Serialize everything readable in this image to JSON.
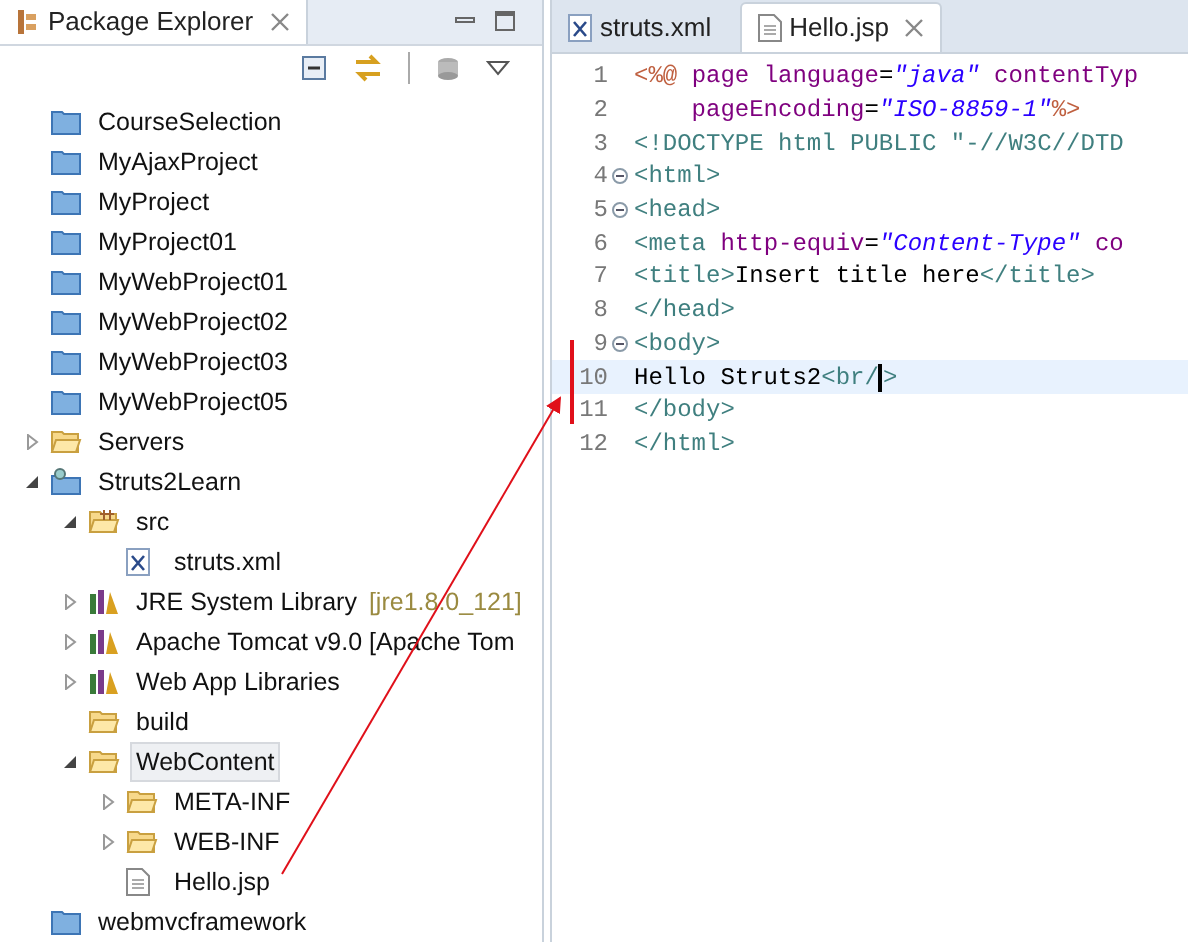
{
  "explorer": {
    "title": "Package Explorer",
    "tree": [
      {
        "label": "CourseSelection",
        "kind": "project"
      },
      {
        "label": "MyAjaxProject",
        "kind": "project"
      },
      {
        "label": "MyProject",
        "kind": "project"
      },
      {
        "label": "MyProject01",
        "kind": "project"
      },
      {
        "label": "MyWebProject01",
        "kind": "project"
      },
      {
        "label": "MyWebProject02",
        "kind": "project"
      },
      {
        "label": "MyWebProject03",
        "kind": "project"
      },
      {
        "label": "MyWebProject05",
        "kind": "project"
      },
      {
        "label": "Servers",
        "kind": "folder",
        "expanded": false
      },
      {
        "label": "Struts2Learn",
        "kind": "web-project",
        "expanded": true,
        "children": [
          {
            "label": "src",
            "kind": "source-folder",
            "expanded": true,
            "children": [
              {
                "label": "struts.xml",
                "kind": "xml-file"
              }
            ]
          },
          {
            "label": "JRE System Library",
            "decoration": "[jre1.8.0_121]",
            "kind": "library",
            "expanded": false
          },
          {
            "label": "Apache Tomcat v9.0 [Apache Tom",
            "kind": "library",
            "expanded": false
          },
          {
            "label": "Web App Libraries",
            "kind": "library",
            "expanded": false
          },
          {
            "label": "build",
            "kind": "folder"
          },
          {
            "label": "WebContent",
            "kind": "folder",
            "expanded": true,
            "selected": true,
            "children": [
              {
                "label": "META-INF",
                "kind": "folder",
                "expanded": false
              },
              {
                "label": "WEB-INF",
                "kind": "folder",
                "expanded": false
              },
              {
                "label": "Hello.jsp",
                "kind": "file"
              }
            ]
          }
        ]
      },
      {
        "label": "webmvcframework",
        "kind": "project"
      }
    ]
  },
  "editor": {
    "tabs": [
      {
        "label": "struts.xml",
        "kind": "xml-file",
        "selected": false
      },
      {
        "label": "Hello.jsp",
        "kind": "file",
        "selected": true
      }
    ],
    "lines": [
      {
        "number": "1",
        "tokens": [
          {
            "kind": "jsp",
            "text": "<%@ "
          },
          {
            "kind": "attr",
            "text": "page language"
          },
          {
            "kind": "text",
            "text": "="
          },
          {
            "kind": "value",
            "text": "\"java\""
          },
          {
            "kind": "attr",
            "text": " contentTyp"
          }
        ]
      },
      {
        "number": "2",
        "tokens": [
          {
            "kind": "attr",
            "text": "    pageEncoding"
          },
          {
            "kind": "text",
            "text": "="
          },
          {
            "kind": "value",
            "text": "\"ISO-8859-1\""
          },
          {
            "kind": "jsp",
            "text": "%>"
          }
        ]
      },
      {
        "number": "3",
        "tokens": [
          {
            "kind": "tag",
            "text": "<!DOCTYPE html PUBLIC \"-//W3C//DTD"
          }
        ]
      },
      {
        "number": "4",
        "fold": true,
        "tokens": [
          {
            "kind": "tag",
            "text": "<html>"
          }
        ]
      },
      {
        "number": "5",
        "fold": true,
        "tokens": [
          {
            "kind": "tag",
            "text": "<head>"
          }
        ]
      },
      {
        "number": "6",
        "tokens": [
          {
            "kind": "tag",
            "text": "<meta "
          },
          {
            "kind": "attr",
            "text": "http-equiv"
          },
          {
            "kind": "text",
            "text": "="
          },
          {
            "kind": "value",
            "text": "\"Content-Type\""
          },
          {
            "kind": "attr",
            "text": " co"
          }
        ]
      },
      {
        "number": "7",
        "tokens": [
          {
            "kind": "tag",
            "text": "<title>"
          },
          {
            "kind": "text",
            "text": "Insert title here"
          },
          {
            "kind": "tag",
            "text": "</title>"
          }
        ]
      },
      {
        "number": "8",
        "tokens": [
          {
            "kind": "tag",
            "text": "</head>"
          }
        ]
      },
      {
        "number": "9",
        "fold": true,
        "tokens": [
          {
            "kind": "tag",
            "text": "<body>"
          }
        ]
      },
      {
        "number": "10",
        "current": true,
        "tokens": [
          {
            "kind": "text",
            "text": "Hello Struts2"
          },
          {
            "kind": "tag",
            "text": "<br/",
            "caret": true
          },
          {
            "kind": "tag",
            "text": ">"
          }
        ]
      },
      {
        "number": "11",
        "tokens": [
          {
            "kind": "tag",
            "text": "</body>"
          }
        ]
      },
      {
        "number": "12",
        "tokens": [
          {
            "kind": "tag",
            "text": "</html>"
          }
        ]
      }
    ]
  }
}
